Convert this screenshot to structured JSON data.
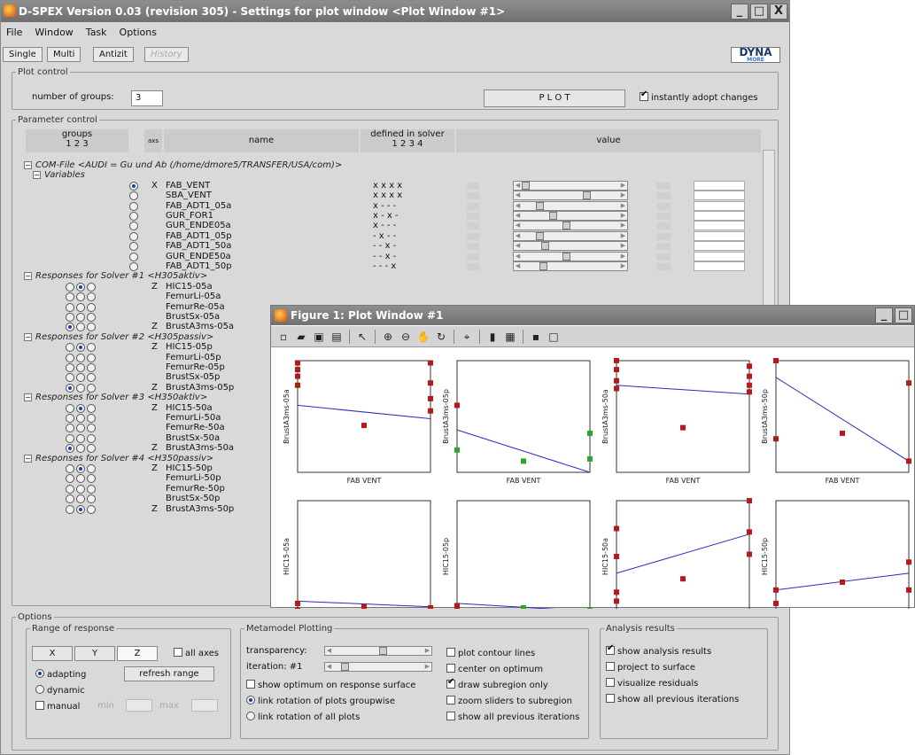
{
  "window": {
    "title": "D-SPEX Version 0.03 (revision 305) - Settings for plot window <Plot Window #1>",
    "min": "_",
    "max": "□",
    "close": "X"
  },
  "menu": [
    "File",
    "Window",
    "Task",
    "Options"
  ],
  "tabs": [
    "Single",
    "Multi",
    "Antizit",
    "History"
  ],
  "logo": {
    "text": "DYNA",
    "sub": "MORE"
  },
  "plot_control": {
    "legend": "Plot control",
    "groups_label": "number of groups:",
    "groups_value": "3",
    "plot_button": "P L O T",
    "instant_label": "instantly adopt changes",
    "instant_checked": true
  },
  "param_control": {
    "legend": "Parameter control",
    "hdr_groups": "groups",
    "hdr_groups_nums": "1  2  3",
    "hdr_axis": "axs",
    "hdr_name": "name",
    "hdr_defined": "defined in solver",
    "hdr_defined_nums": "1  2  3  4",
    "hdr_value": "value",
    "com_file": "COM-File <AUDI = Gu und Ab (/home/dmore5/TRANSFER/USA/com)>",
    "variables_label": "Variables",
    "variables": [
      {
        "axis": "X",
        "name": "FAB_VENT",
        "defined": "x  x  x  x",
        "thumb": 0
      },
      {
        "axis": "",
        "name": "SBA_VENT",
        "defined": "x  x  x  x",
        "thumb": 0.68
      },
      {
        "axis": "",
        "name": "FAB_ADT1_05a",
        "defined": "x  -  -  -",
        "thumb": 0.16
      },
      {
        "axis": "",
        "name": "GUR_FOR1",
        "defined": "x  -  x  -",
        "thumb": 0.3
      },
      {
        "axis": "",
        "name": "GUR_ENDE05a",
        "defined": "x  -  -  -",
        "thumb": 0.45
      },
      {
        "axis": "",
        "name": "FAB_ADT1_05p",
        "defined": "-  x  -  -",
        "thumb": 0.16
      },
      {
        "axis": "",
        "name": "FAB_ADT1_50a",
        "defined": "-  -  x  -",
        "thumb": 0.22
      },
      {
        "axis": "",
        "name": "GUR_ENDE50a",
        "defined": "-  -  x  -",
        "thumb": 0.45
      },
      {
        "axis": "",
        "name": "FAB_ADT1_50p",
        "defined": "-  -  -  x",
        "thumb": 0.2
      }
    ],
    "solvers": [
      {
        "label": "Responses for Solver #1 <H305aktiv>",
        "rows": [
          {
            "sel": 1,
            "axis": "Z",
            "name": "HIC15-05a"
          },
          {
            "sel": -1,
            "axis": "",
            "name": "FemurLi-05a"
          },
          {
            "sel": -1,
            "axis": "",
            "name": "FemurRe-05a"
          },
          {
            "sel": -1,
            "axis": "",
            "name": "BrustSx-05a"
          },
          {
            "sel": 0,
            "axis": "Z",
            "name": "BrustA3ms-05a"
          }
        ]
      },
      {
        "label": "Responses for Solver #2 <H305passiv>",
        "rows": [
          {
            "sel": 1,
            "axis": "Z",
            "name": "HIC15-05p"
          },
          {
            "sel": -1,
            "axis": "",
            "name": "FemurLi-05p"
          },
          {
            "sel": -1,
            "axis": "",
            "name": "FemurRe-05p"
          },
          {
            "sel": -1,
            "axis": "",
            "name": "BrustSx-05p"
          },
          {
            "sel": 0,
            "axis": "Z",
            "name": "BrustA3ms-05p"
          }
        ]
      },
      {
        "label": "Responses for Solver #3 <H350aktiv>",
        "rows": [
          {
            "sel": 1,
            "axis": "Z",
            "name": "HIC15-50a"
          },
          {
            "sel": -1,
            "axis": "",
            "name": "FemurLi-50a"
          },
          {
            "sel": -1,
            "axis": "",
            "name": "FemurRe-50a"
          },
          {
            "sel": -1,
            "axis": "",
            "name": "BrustSx-50a"
          },
          {
            "sel": 0,
            "axis": "Z",
            "name": "BrustA3ms-50a"
          }
        ]
      },
      {
        "label": "Responses for Solver #4 <H350passiv>",
        "rows": [
          {
            "sel": 1,
            "axis": "Z",
            "name": "HIC15-50p"
          },
          {
            "sel": -1,
            "axis": "",
            "name": "FemurLi-50p"
          },
          {
            "sel": -1,
            "axis": "",
            "name": "FemurRe-50p"
          },
          {
            "sel": -1,
            "axis": "",
            "name": "BrustSx-50p"
          },
          {
            "sel": 1,
            "axis": "Z",
            "name": "BrustA3ms-50p"
          }
        ]
      }
    ]
  },
  "options": {
    "legend": "Options",
    "range": {
      "legend": "Range of response",
      "x": "X",
      "y": "Y",
      "z": "Z",
      "all_axes": "all axes",
      "adapting": "adapting",
      "dynamic": "dynamic",
      "manual": "manual",
      "refresh": "refresh range",
      "min": "min",
      "max": "max"
    },
    "meta": {
      "legend": "Metamodel Plotting",
      "transparency": "transparency:",
      "iteration": "iteration: #1",
      "show_optimum": "show optimum on response surface",
      "link_groupwise": "link rotation of plots groupwise",
      "link_all": "link rotation of all plots",
      "plot_contour": "plot contour lines",
      "center_optimum": "center on optimum",
      "draw_subregion": "draw subregion only",
      "zoom_sliders": "zoom sliders to subregion",
      "show_prev": "show all previous iterations",
      "transparency_level": 0.55,
      "iteration_level": 0.1
    },
    "analysis": {
      "legend": "Analysis results",
      "show_analysis": "show analysis results",
      "project": "project to surface",
      "visualize": "visualize residuals",
      "show_prev": "show all previous iterations"
    }
  },
  "figure": {
    "title": "Figure 1: Plot Window #1",
    "xlabel": "FAB VENT",
    "plots": [
      {
        "ylabel": "BrustA3ms-05a",
        "line": [
          0.6,
          0.48
        ],
        "red": [
          [
            0.0,
            0.98
          ],
          [
            0.0,
            0.92
          ],
          [
            0.0,
            0.86
          ],
          [
            0.0,
            0.78
          ],
          [
            0.5,
            0.42
          ],
          [
            1.0,
            0.98
          ],
          [
            1.0,
            0.8
          ],
          [
            1.0,
            0.66
          ],
          [
            1.0,
            0.55
          ]
        ],
        "green": []
      },
      {
        "ylabel": "BrustA3ms-05p",
        "line": [
          0.38,
          0.0
        ],
        "red": [
          [
            0.0,
            0.6
          ]
        ],
        "green": [
          [
            0.0,
            0.2
          ],
          [
            0.5,
            0.1
          ],
          [
            1.0,
            0.35
          ],
          [
            1.0,
            0.12
          ]
        ]
      },
      {
        "ylabel": "BrustA3ms-50a",
        "line": [
          0.78,
          0.7
        ],
        "red": [
          [
            0.0,
            1.0
          ],
          [
            0.0,
            0.92
          ],
          [
            0.0,
            0.82
          ],
          [
            0.0,
            0.75
          ],
          [
            0.5,
            0.4
          ],
          [
            1.0,
            0.95
          ],
          [
            1.0,
            0.86
          ],
          [
            1.0,
            0.78
          ],
          [
            1.0,
            0.72
          ]
        ],
        "green": []
      },
      {
        "ylabel": "BrustA3ms-50p",
        "line": [
          0.85,
          0.1
        ],
        "red": [
          [
            0.0,
            1.0
          ],
          [
            0.0,
            0.3
          ],
          [
            0.5,
            0.35
          ],
          [
            1.0,
            0.8
          ],
          [
            1.0,
            0.1
          ]
        ],
        "green": []
      },
      {
        "ylabel": "HIC15-05a",
        "line": [
          0.1,
          0.05
        ],
        "red": [
          [
            0.0,
            0.08
          ],
          [
            0.0,
            0.02
          ],
          [
            0.5,
            0.05
          ],
          [
            1.0,
            0.04
          ]
        ],
        "green": []
      },
      {
        "ylabel": "HIC15-05p",
        "line": [
          0.08,
          0.01
        ],
        "red": [
          [
            0.0,
            0.06
          ],
          [
            0.0,
            0.02
          ]
        ],
        "green": [
          [
            0.5,
            0.04
          ],
          [
            1.0,
            0.02
          ]
        ]
      },
      {
        "ylabel": "HIC15-50a",
        "line": [
          0.35,
          0.7
        ],
        "red": [
          [
            0.0,
            0.75
          ],
          [
            0.0,
            0.5
          ],
          [
            0.0,
            0.18
          ],
          [
            0.0,
            0.1
          ],
          [
            0.5,
            0.3
          ],
          [
            1.0,
            1.0
          ],
          [
            1.0,
            0.72
          ],
          [
            1.0,
            0.52
          ]
        ],
        "green": []
      },
      {
        "ylabel": "HIC15-50p",
        "line": [
          0.2,
          0.35
        ],
        "red": [
          [
            0.0,
            0.2
          ],
          [
            0.0,
            0.08
          ],
          [
            0.5,
            0.27
          ],
          [
            1.0,
            0.45
          ],
          [
            1.0,
            0.2
          ]
        ],
        "green": []
      }
    ]
  },
  "colors": {
    "line": "#2a2ab8",
    "red": "#b81818",
    "green": "#2fa52f"
  }
}
